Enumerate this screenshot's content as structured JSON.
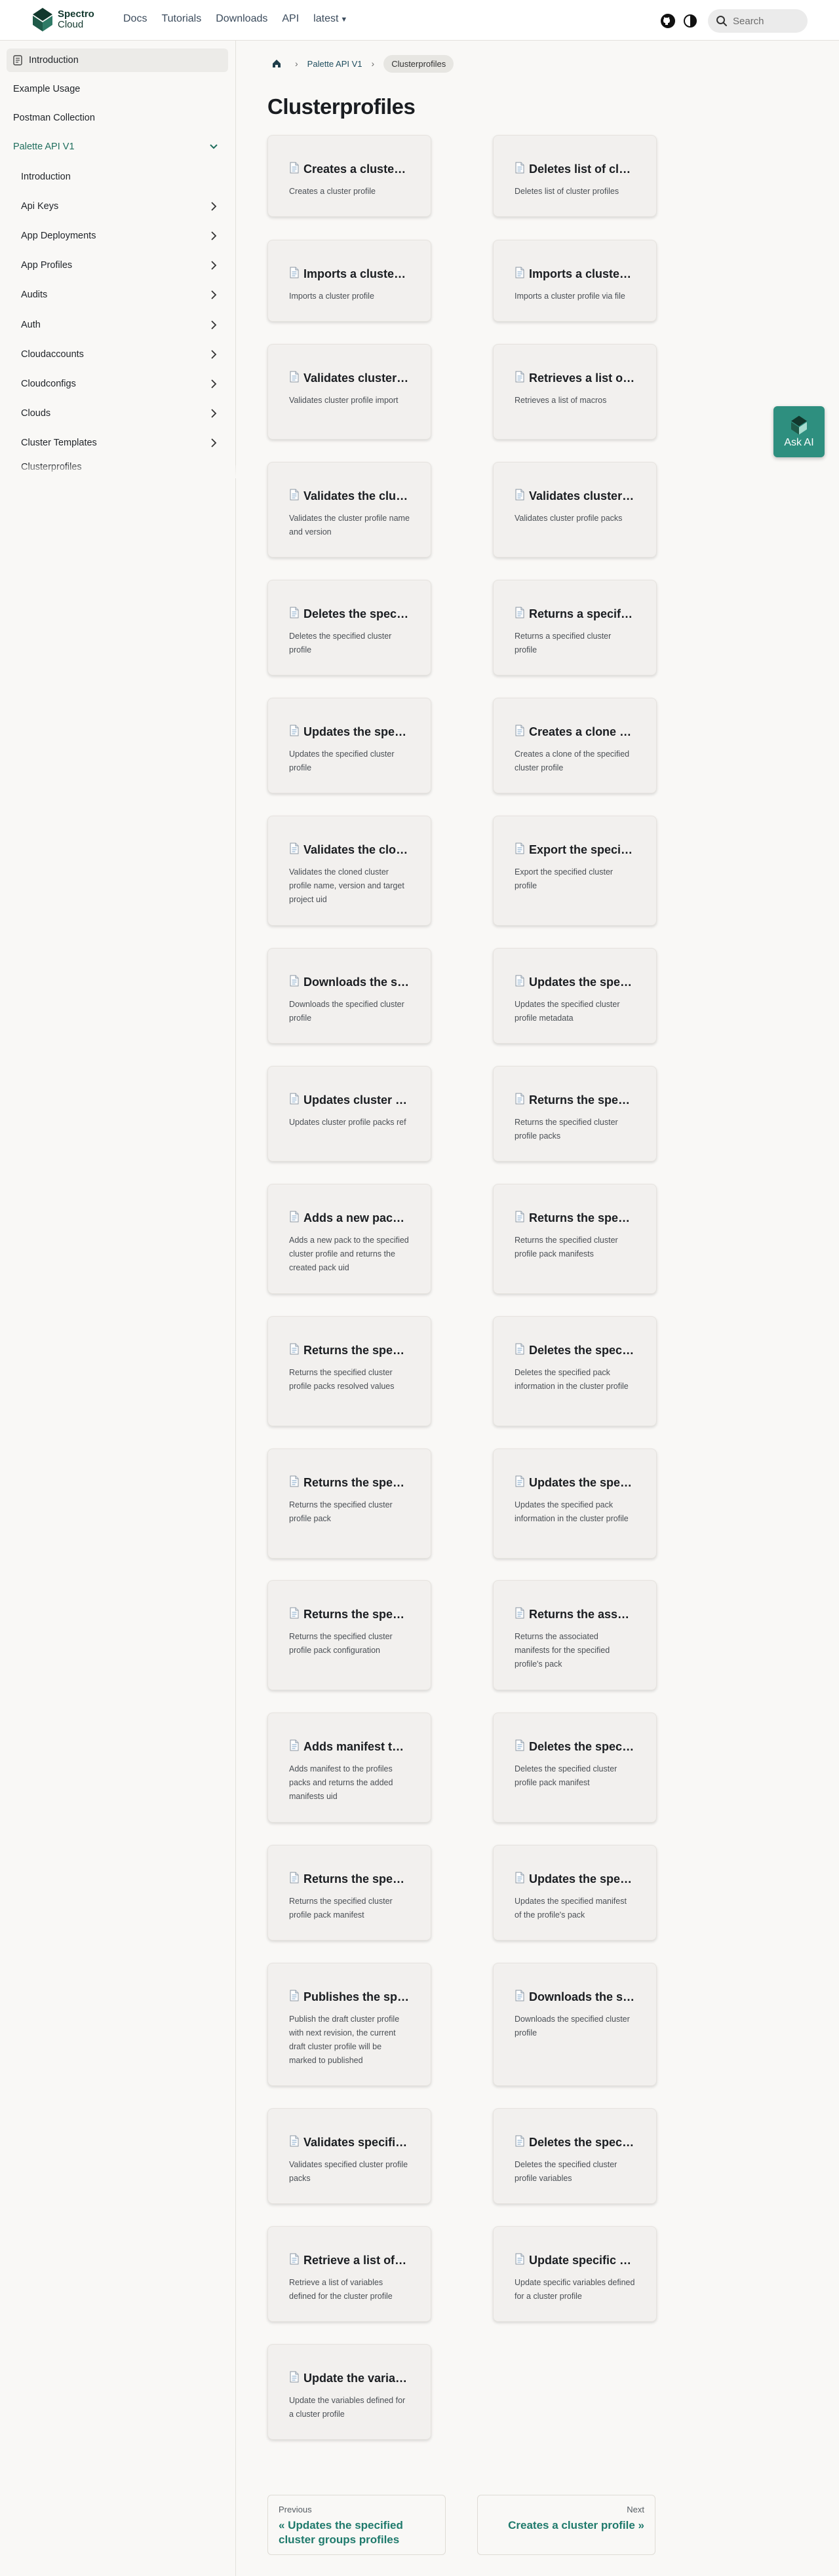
{
  "brand": {
    "line1": "Spectro",
    "line2": "Cloud"
  },
  "nav": {
    "links": [
      "Docs",
      "Tutorials",
      "Downloads",
      "API"
    ],
    "version": "latest",
    "search_placeholder": "Search"
  },
  "sidebar": {
    "top_items": [
      "Introduction",
      "Example Usage",
      "Postman Collection",
      "Palette API V1"
    ],
    "sub_items": [
      "Introduction",
      "Api Keys",
      "App Deployments",
      "App Profiles",
      "Audits",
      "Auth",
      "Cloudaccounts",
      "Cloudconfigs",
      "Clouds",
      "Cluster Templates",
      "Clusterprofiles"
    ]
  },
  "breadcrumb": {
    "parent": "Palette API V1",
    "current": "Clusterprofiles"
  },
  "page": {
    "title": "Clusterprofiles"
  },
  "cards": [
    {
      "title": "Creates a cluster profile",
      "desc": "Creates a cluster profile"
    },
    {
      "title": "Deletes list of cluster profiles",
      "desc": "Deletes list of cluster profiles"
    },
    {
      "title": "Imports a cluster profile",
      "desc": "Imports a cluster profile"
    },
    {
      "title": "Imports a cluster profile via file",
      "desc": "Imports a cluster profile via file"
    },
    {
      "title": "Validates cluster profile import",
      "desc": "Validates cluster profile import"
    },
    {
      "title": "Retrieves a list of macros",
      "desc": "Retrieves a list of macros"
    },
    {
      "title": "Validates the cluster profile name and version",
      "desc": "Validates the cluster profile name and version"
    },
    {
      "title": "Validates cluster profile packs",
      "desc": "Validates cluster profile packs"
    },
    {
      "title": "Deletes the specified cluster profile",
      "desc": "Deletes the specified cluster profile"
    },
    {
      "title": "Returns a specified cluster profile",
      "desc": "Returns a specified cluster profile"
    },
    {
      "title": "Updates the specified cluster profile",
      "desc": "Updates the specified cluster profile"
    },
    {
      "title": "Creates a clone of the specified cluster profile",
      "desc": "Creates a clone of the specified cluster profile"
    },
    {
      "title": "Validates the cloned cluster profile",
      "desc": "Validates the cloned cluster profile name, version and target project uid"
    },
    {
      "title": "Export the specified cluster profile",
      "desc": "Export the specified cluster profile"
    },
    {
      "title": "Downloads the specified cluster profile",
      "desc": "Downloads the specified cluster profile"
    },
    {
      "title": "Updates the specified cluster profile metadata",
      "desc": "Updates the specified cluster profile metadata"
    },
    {
      "title": "Updates cluster profile packs ref",
      "desc": "Updates cluster profile packs ref"
    },
    {
      "title": "Returns the specified cluster profile packs",
      "desc": "Returns the specified cluster profile packs"
    },
    {
      "title": "Adds a new pack to the specified cluster profile",
      "desc": "Adds a new pack to the specified cluster profile and returns the created pack uid"
    },
    {
      "title": "Returns the specified cluster profile pack manifests",
      "desc": "Returns the specified cluster profile pack manifests"
    },
    {
      "title": "Returns the specified cluster profile packs resolved values",
      "desc": "Returns the specified cluster profile packs resolved values"
    },
    {
      "title": "Deletes the specified pack information",
      "desc": "Deletes the specified pack information in the cluster profile"
    },
    {
      "title": "Returns the specified cluster profile pack",
      "desc": "Returns the specified cluster profile pack"
    },
    {
      "title": "Updates the specified pack information",
      "desc": "Updates the specified pack information in the cluster profile"
    },
    {
      "title": "Returns the specified cluster profile pack configuration",
      "desc": "Returns the specified cluster profile pack configuration"
    },
    {
      "title": "Returns the associated manifests",
      "desc": "Returns the associated manifests for the specified profile's pack"
    },
    {
      "title": "Adds manifest to the profiles packs",
      "desc": "Adds manifest to the profiles packs and returns the added manifests uid"
    },
    {
      "title": "Deletes the specified cluster profile pack manifest",
      "desc": "Deletes the specified cluster profile pack manifest"
    },
    {
      "title": "Returns the specified cluster profile pack manifest",
      "desc": "Returns the specified cluster profile pack manifest"
    },
    {
      "title": "Updates the specified manifest",
      "desc": "Updates the specified manifest of the profile's pack"
    },
    {
      "title": "Publishes the specified cluster profile",
      "desc": "Publish the draft cluster profile with next revision, the current draft cluster profile will be marked to published"
    },
    {
      "title": "Downloads the specified cluster profile",
      "desc": "Downloads the specified cluster profile"
    },
    {
      "title": "Validates specified cluster profile packs",
      "desc": "Validates specified cluster profile packs"
    },
    {
      "title": "Deletes the specified cluster profile variables",
      "desc": "Deletes the specified cluster profile variables"
    },
    {
      "title": "Retrieve a list of variables",
      "desc": "Retrieve a list of variables defined for the cluster profile"
    },
    {
      "title": "Update specific variables",
      "desc": "Update specific variables defined for a cluster profile"
    },
    {
      "title": "Update the variables defined",
      "desc": "Update the variables defined for a cluster profile"
    }
  ],
  "pagination": {
    "prev_label": "Previous",
    "prev_title": "« Updates the specified cluster groups profiles",
    "next_label": "Next",
    "next_title": "Creates a cluster profile »"
  },
  "ask_ai": {
    "label": "Ask AI"
  },
  "colors": {
    "brand": "#12382d",
    "accent": "#2e8f7f",
    "link": "#1f7a6c"
  }
}
